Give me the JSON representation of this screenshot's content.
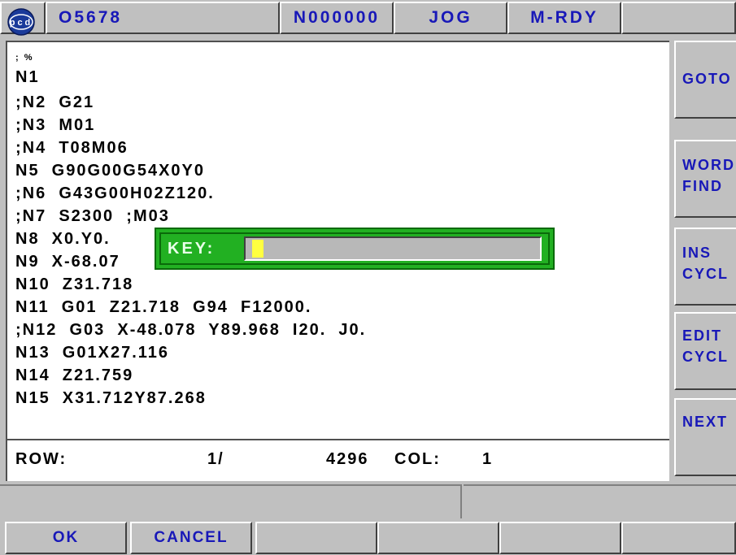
{
  "header": {
    "logo_text": "pcd",
    "program": "O5678",
    "sequence": "N000000",
    "mode": "JOG",
    "status": "M-RDY"
  },
  "editor": {
    "lines": [
      "; %",
      "N1",
      ";N2  G21",
      ";N3  M01",
      ";N4  T08M06",
      "N5  G90G00G54X0Y0",
      ";N6  G43G00H02Z120.",
      ";N7  S2300  ;M03",
      "N8  X0.Y0.",
      "N9  X-68.07",
      "N10  Z31.718",
      "N11  G01  Z21.718  G94  F12000.",
      ";N12  G03  X-48.078  Y89.968  I20.  J0.",
      "N13  G01X27.116",
      "N14  Z21.759",
      "N15  X31.712Y87.268"
    ]
  },
  "status_row": {
    "row_label": "ROW:",
    "row_value": "1/",
    "row_total": "4296",
    "col_label": "COL:",
    "col_value": "1"
  },
  "dialog": {
    "label": "KEY:",
    "value": ""
  },
  "side_keys": [
    {
      "line1": "GOTO",
      "line2": ""
    },
    {
      "line1": "WORD",
      "line2": "FIND"
    },
    {
      "line1": "INS",
      "line2": "CYCL"
    },
    {
      "line1": "EDIT",
      "line2": "CYCL"
    },
    {
      "line1": "NEXT",
      "line2": ""
    }
  ],
  "bottom_keys": [
    "OK",
    "CANCEL",
    "",
    "",
    "",
    "",
    ""
  ],
  "colors": {
    "key_text": "#1818b8",
    "dialog_bg": "#22b022",
    "cursor": "#ffff40"
  }
}
